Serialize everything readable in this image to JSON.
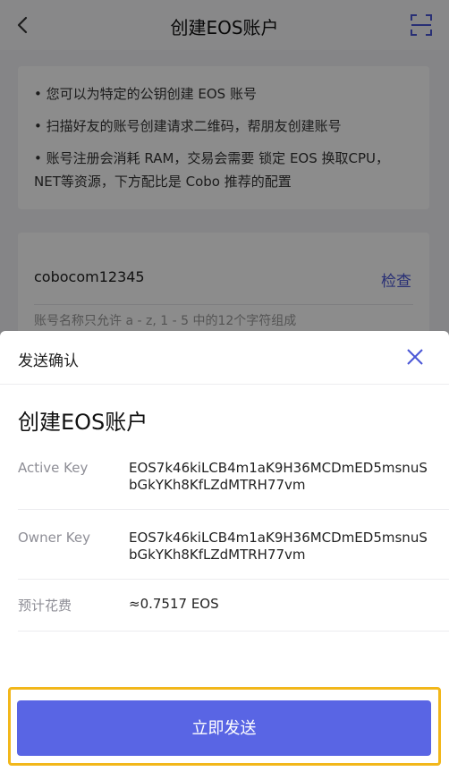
{
  "navbar": {
    "title": "创建EOS账户",
    "back_icon": "chevron-left-icon",
    "scan_icon": "scan-icon"
  },
  "info": {
    "items": [
      "• 您可以为特定的公钥创建 EOS 账号",
      "• 扫描好友的账号创建请求二维码，帮朋友创建账号",
      "• 账号注册会消耗 RAM，交易会需要 锁定 EOS 换取CPU，NET等资源，下方配比是 Cobo 推荐的配置"
    ]
  },
  "account": {
    "name_value": "cobocom12345",
    "check_label": "检查",
    "hint": "账号名称只允许 a - z, 1 - 5 中的12个字符组成"
  },
  "sheet": {
    "title": "发送确认",
    "close_icon": "close-icon",
    "heading": "创建EOS账户",
    "rows": [
      {
        "label": "Active Key",
        "value": "EOS7k46kiLCB4m1aK9H36MCDmED5msnuSbGkYKh8KfLZdMTRH77vm"
      },
      {
        "label": "Owner Key",
        "value": "EOS7k46kiLCB4m1aK9H36MCDmED5msnuSbGkYKh8KfLZdMTRH77vm"
      },
      {
        "label": "预计花费",
        "value": "≈0.7517 EOS"
      }
    ],
    "send_label": "立即发送"
  },
  "colors": {
    "accent": "#5965e4",
    "highlight": "#f2b71a",
    "link": "#4a56d6"
  }
}
